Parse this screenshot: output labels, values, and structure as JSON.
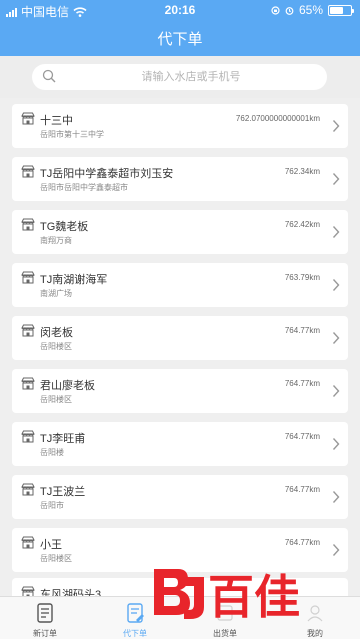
{
  "status_bar": {
    "carrier": "中国电信",
    "time": "20:16",
    "battery": "65%",
    "battery_level": 0.65
  },
  "header": {
    "title": "代下单"
  },
  "search": {
    "placeholder": "请输入水店或手机号"
  },
  "stores": [
    {
      "name": "十三中",
      "address": "岳阳市第十三中学",
      "distance": "762.0700000000001km"
    },
    {
      "name": "TJ岳阳中学鑫泰超市刘玉安",
      "address": "岳阳市岳阳中学鑫泰超市",
      "distance": "762.34km"
    },
    {
      "name": "TG魏老板",
      "address": "南翔万商",
      "distance": "762.42km"
    },
    {
      "name": "TJ南湖谢海军",
      "address": "南湖广场",
      "distance": "763.79km"
    },
    {
      "name": "闵老板",
      "address": "岳阳楼区",
      "distance": "764.77km"
    },
    {
      "name": "君山廖老板",
      "address": "岳阳楼区",
      "distance": "764.77km"
    },
    {
      "name": "TJ李旺甫",
      "address": "岳阳楼",
      "distance": "764.77km"
    },
    {
      "name": "TJ王波兰",
      "address": "岳阳市",
      "distance": "764.77km"
    },
    {
      "name": "小王",
      "address": "岳阳楼区",
      "distance": "764.77km"
    },
    {
      "name": "东风湖码头3",
      "address": "",
      "distance": ""
    }
  ],
  "tabbar": {
    "items": [
      {
        "label": "新订单",
        "icon": "new-order-icon",
        "active": false
      },
      {
        "label": "代下单",
        "icon": "proxy-order-icon",
        "active": true
      },
      {
        "label": "出货单",
        "icon": "shipment-icon",
        "active": false
      },
      {
        "label": "我的",
        "icon": "profile-icon",
        "active": false
      }
    ]
  },
  "watermark": {
    "text": "百佳"
  },
  "colors": {
    "primary": "#5aa9f3",
    "background": "#efefef",
    "watermark": "#e8252b"
  }
}
